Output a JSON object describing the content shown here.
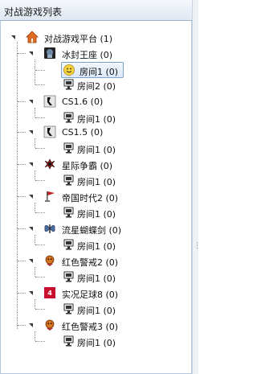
{
  "panel": {
    "title": "对战游戏列表"
  },
  "tree": {
    "root": {
      "label": "对战游戏平台 (1)"
    },
    "games": [
      {
        "label": "冰封王座 (0)",
        "icon": "frozen-throne-icon",
        "rooms": [
          "房间1 (0)",
          "房间2 (0)"
        ]
      },
      {
        "label": "CS1.6 (0)",
        "icon": "cs-icon",
        "rooms": [
          "房间1 (0)"
        ]
      },
      {
        "label": "CS1.5 (0)",
        "icon": "cs-icon",
        "rooms": [
          "房间1 (0)"
        ]
      },
      {
        "label": "星际争霸 (0)",
        "icon": "starcraft-icon",
        "rooms": [
          "房间1 (0)"
        ]
      },
      {
        "label": "帝国时代2 (0)",
        "icon": "age-of-empires-icon",
        "rooms": [
          "房间1 (0)"
        ]
      },
      {
        "label": "流星蝴蝶剑 (0)",
        "icon": "meteor-butterfly-sword-icon",
        "rooms": [
          "房间1 (0)"
        ]
      },
      {
        "label": "红色警戒2 (0)",
        "icon": "red-alert-icon",
        "rooms": [
          "房间1 (0)"
        ]
      },
      {
        "label": "实况足球8 (0)",
        "icon": "winning-eleven-icon",
        "rooms": [
          "房间1 (0)"
        ]
      },
      {
        "label": "红色警戒3 (0)",
        "icon": "red-alert-icon",
        "rooms": [
          "房间1 (0)"
        ]
      }
    ]
  },
  "selected_room": "冰封王座/房间1"
}
